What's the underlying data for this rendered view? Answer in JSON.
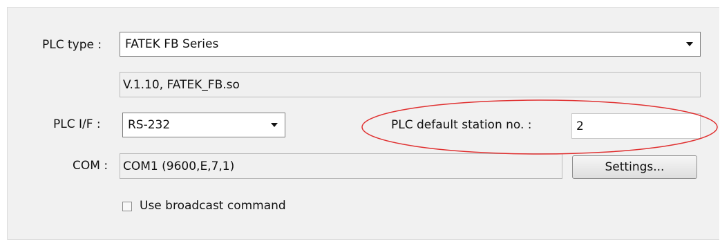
{
  "plc_type": {
    "label": "PLC type :",
    "value": "FATEK FB Series",
    "driver_info": "V.1.10, FATEK_FB.so"
  },
  "plc_if": {
    "label": "PLC I/F :",
    "value": "RS-232"
  },
  "station": {
    "label": "PLC default station no. :",
    "value": "2",
    "highlight_color": "#e03030"
  },
  "com": {
    "label": "COM :",
    "value": "COM1 (9600,E,7,1)",
    "settings_button": "Settings..."
  },
  "broadcast": {
    "label": "Use broadcast command",
    "checked": false
  }
}
